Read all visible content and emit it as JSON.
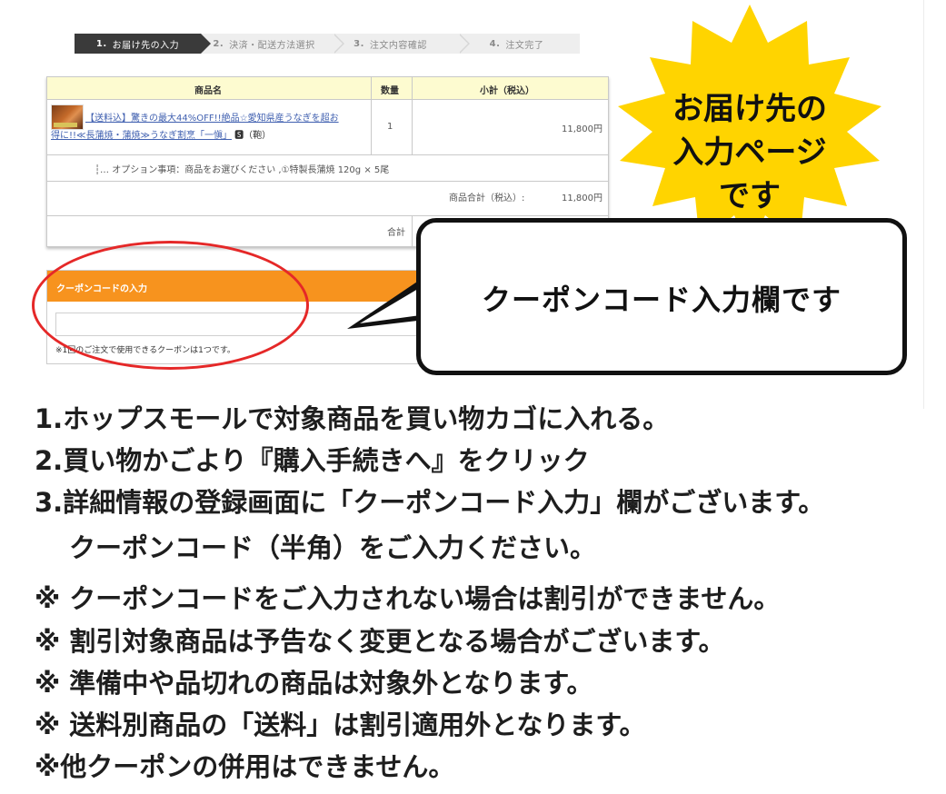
{
  "steps": [
    {
      "num": "1.",
      "label": "お届け先の入力",
      "active": true
    },
    {
      "num": "2.",
      "label": "決済・配送方法選択",
      "active": false
    },
    {
      "num": "3.",
      "label": "注文内容確認",
      "active": false
    },
    {
      "num": "4.",
      "label": "注文完了",
      "active": false
    }
  ],
  "cart": {
    "headers": {
      "product": "商品名",
      "qty": "数量",
      "subtotal": "小計（税込）"
    },
    "item": {
      "name_line1": "【送料込】驚きの最大44%OFF!!絶品☆愛知県産うなぎを超お",
      "name_line2": "得に!!≪長蒲焼・蒲焼≫うなぎ割烹「一愼」",
      "postage_mark": "🆂（鞄）",
      "qty": "1",
      "subtotal": "11,800円"
    },
    "option": "┆… オプション事項：商品をお選びください ,①特製長蒲焼 120g × 5尾",
    "total_label": "商品合計（税込）:",
    "total_value": "11,800円",
    "grand_label": "合計"
  },
  "coupon": {
    "title": "クーポンコードの入力",
    "input_value": "",
    "placeholder": "",
    "note": "※1回のご注文で使用できるクーポンは1つです。"
  },
  "callouts": {
    "star_line1": "お届け先の",
    "star_line2": "入力ページ",
    "star_line3": "です",
    "bubble": "クーポンコード入力欄です"
  },
  "instructions": [
    "1.ホップスモールで対象商品を買い物カゴに入れる。",
    "2.買い物かごより『購入手続きへ』をクリック",
    "3.詳細情報の登録画面に「クーポンコード入力」欄がございます。",
    "クーポンコード（半角）をご入力ください。",
    "※ クーポンコードをご入力されない場合は割引ができません。",
    "※ 割引対象商品は予告なく変更となる場合がございます。",
    "※ 準備中や品切れの商品は対象外となります。",
    "※ 送料別商品の「送料」は割引適用外となります。",
    "※他クーポンの併用はできません。"
  ],
  "colors": {
    "step_active": "#3a3a3a",
    "table_header": "#fdfbd0",
    "coupon_bar": "#f7931e",
    "ring": "#e52828",
    "star": "#ffd400",
    "link": "#4060b0"
  }
}
